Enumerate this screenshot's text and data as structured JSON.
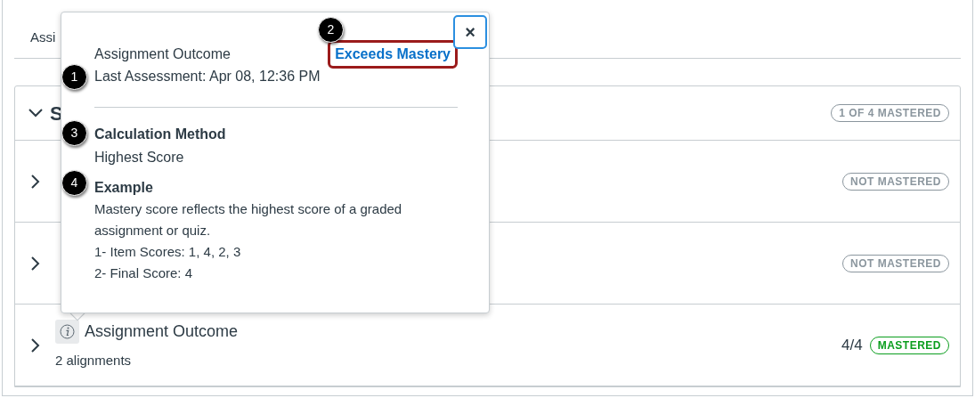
{
  "tabs": [
    {
      "label": "Assi"
    }
  ],
  "group": {
    "title": "S",
    "expanded": true,
    "badge": "1 OF 4 MASTERED"
  },
  "outcomes": [
    {
      "expanded": false,
      "badge": "NOT MASTERED",
      "mastered": false
    },
    {
      "expanded": false,
      "badge": "NOT MASTERED",
      "mastered": false
    },
    {
      "expanded": false,
      "title": "Assignment Outcome",
      "subtitle": "2 alignments",
      "score": "4/4",
      "badge": "MASTERED",
      "mastered": true
    }
  ],
  "popover": {
    "title": "Assignment Outcome",
    "mastery_level": "Exceeds Mastery",
    "mastery_highlighted": true,
    "last_assessment": "Last Assessment: Apr 08, 12:36 PM",
    "calculation_heading": "Calculation Method",
    "calculation_value": "Highest Score",
    "example_heading": "Example",
    "example_lines": [
      "Mastery score reflects the highest score of a graded assignment or quiz.",
      "1- Item Scores: 1, 4, 2, 3",
      "2- Final Score: 4"
    ],
    "close": "×"
  },
  "callouts": [
    "1",
    "2",
    "3",
    "4"
  ]
}
